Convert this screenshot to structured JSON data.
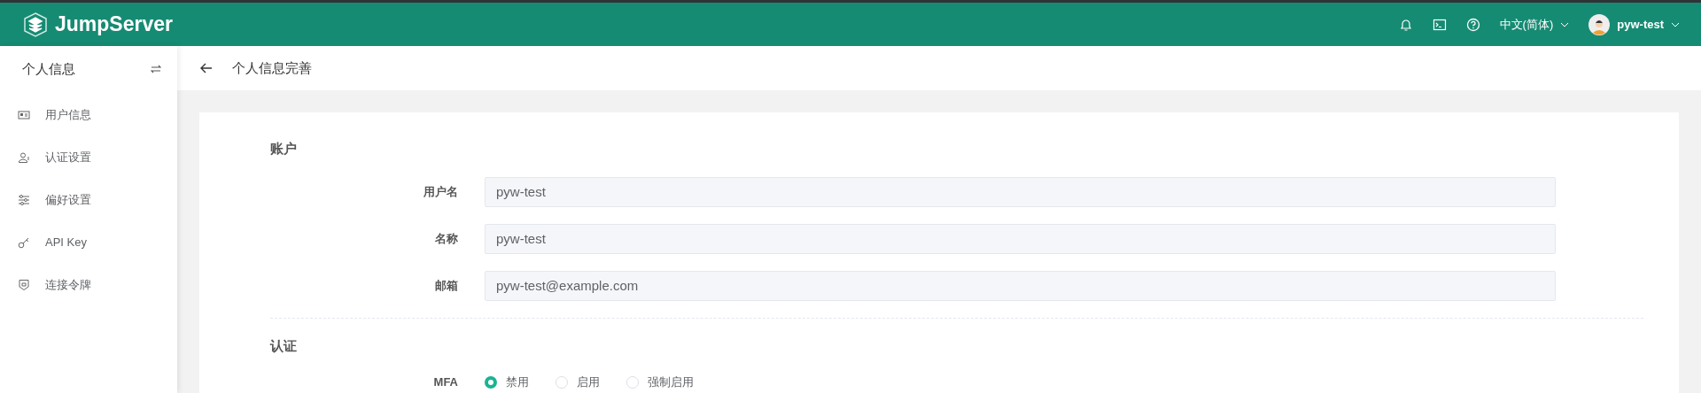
{
  "header": {
    "brand": "JumpServer",
    "language": "中文(简体)",
    "user": "pyw-test"
  },
  "sidebar": {
    "title": "个人信息",
    "items": [
      {
        "label": "用户信息",
        "kind": "card"
      },
      {
        "label": "认证设置",
        "kind": "user"
      },
      {
        "label": "偏好设置",
        "kind": "sliders"
      },
      {
        "label": "API Key",
        "kind": "key"
      },
      {
        "label": "连接令牌",
        "kind": "shield"
      }
    ]
  },
  "page": {
    "title": "个人信息完善"
  },
  "sections": [
    {
      "title": "账户",
      "fields": [
        {
          "label": "用户名",
          "kind": "text",
          "value": "pyw-test"
        },
        {
          "label": "名称",
          "kind": "text",
          "value": "pyw-test"
        },
        {
          "label": "邮箱",
          "kind": "text",
          "value": "pyw-test@example.com"
        }
      ]
    },
    {
      "title": "认证",
      "fields": [
        {
          "label": "MFA",
          "kind": "radio",
          "options": [
            {
              "label": "禁用",
              "selected": true
            },
            {
              "label": "启用",
              "selected": false
            },
            {
              "label": "强制启用",
              "selected": false
            }
          ]
        }
      ]
    }
  ]
}
